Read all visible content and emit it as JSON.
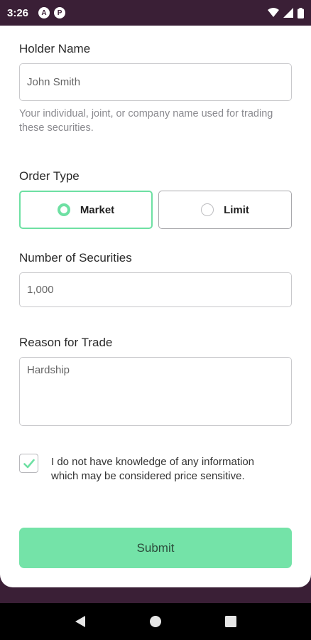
{
  "status_bar": {
    "time": "3:26",
    "app_icon_1": "A",
    "app_icon_2": "P"
  },
  "form": {
    "holder_name": {
      "label": "Holder Name",
      "placeholder": "John Smith",
      "helper": "Your individual, joint, or company name used for trading these securities."
    },
    "order_type": {
      "label": "Order Type",
      "options": [
        {
          "label": "Market",
          "selected": true
        },
        {
          "label": "Limit",
          "selected": false
        }
      ]
    },
    "number_of_securities": {
      "label": "Number of Securities",
      "placeholder": "1,000"
    },
    "reason": {
      "label": "Reason for Trade",
      "placeholder": "Hardship"
    },
    "consent": {
      "checked": true,
      "text": "I do not have knowledge of any information which may be considered price sensitive."
    },
    "submit_label": "Submit"
  },
  "colors": {
    "accent": "#74e3a8",
    "frame": "#3a1f36"
  }
}
